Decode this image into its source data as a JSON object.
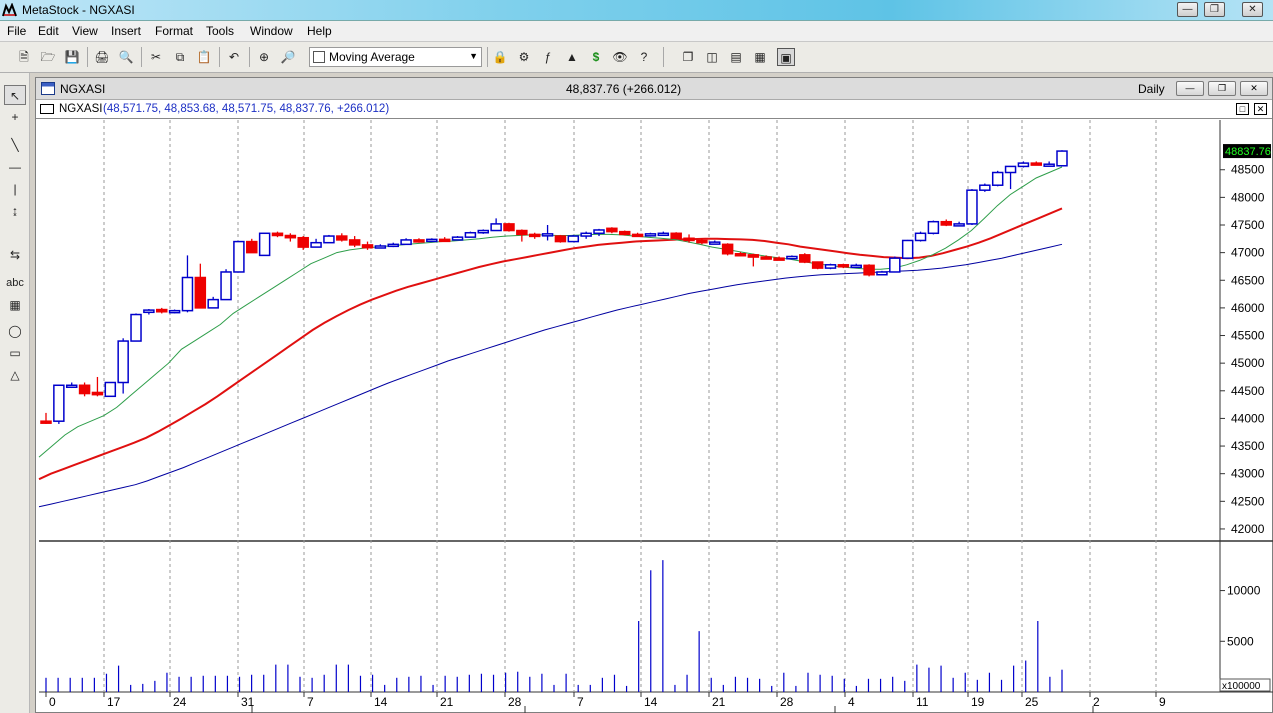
{
  "app": {
    "title": "MetaStock - NGXASI"
  },
  "menu": [
    "File",
    "Edit",
    "View",
    "Insert",
    "Format",
    "Tools",
    "Window",
    "Help"
  ],
  "toolbar": {
    "indicator_select": "Moving Average"
  },
  "window": {
    "title": "NGXASI",
    "price_change": "48,837.76 (+266.012)",
    "periodicity": "Daily"
  },
  "legend": {
    "name": "NGXASI",
    "values": "(48,571.75, 48,853.68, 48,571.75, 48,837.76, +266.012)"
  },
  "colors": {
    "up": "#0000cc",
    "down": "#ee0000",
    "ma_short": "#2e9e4a",
    "ma_mid": "#e01010",
    "ma_long": "#0000a0",
    "last_price_bg": "#000000",
    "last_price_fg": "#22ff22"
  },
  "chart_data": [
    {
      "type": "candlestick",
      "title": "NGXASI",
      "y_ticks": [
        42000,
        42500,
        43000,
        43500,
        44000,
        44500,
        45000,
        45500,
        46000,
        46500,
        47000,
        47500,
        48000,
        48500
      ],
      "y_tick_labels": [
        "42000",
        "42500",
        "43000",
        "43500",
        "44000",
        "44500",
        "45000",
        "45500",
        "46000",
        "46500",
        "47000",
        "47500",
        "48000",
        "48500"
      ],
      "ylim": [
        41800,
        49400
      ],
      "last_price_label": "48837.76",
      "x_tick_labels": [
        "0",
        "17",
        "24",
        "31",
        "7",
        "14",
        "21",
        "28",
        "7",
        "14",
        "21",
        "28",
        "4",
        "11",
        "19",
        "25",
        "2",
        "9"
      ],
      "candles": [
        {
          "o": 43950,
          "h": 44100,
          "l": 43900,
          "c": 43930
        },
        {
          "o": 43950,
          "h": 44600,
          "l": 43900,
          "c": 44600
        },
        {
          "o": 44600,
          "h": 44650,
          "l": 44550,
          "c": 44600
        },
        {
          "o": 44600,
          "h": 44650,
          "l": 44400,
          "c": 44450
        },
        {
          "o": 44470,
          "h": 44750,
          "l": 44400,
          "c": 44430
        },
        {
          "o": 44400,
          "h": 44650,
          "l": 44400,
          "c": 44650
        },
        {
          "o": 44650,
          "h": 45450,
          "l": 44450,
          "c": 45400
        },
        {
          "o": 45400,
          "h": 45900,
          "l": 45400,
          "c": 45880
        },
        {
          "o": 45920,
          "h": 45980,
          "l": 45880,
          "c": 45960
        },
        {
          "o": 45970,
          "h": 46000,
          "l": 45900,
          "c": 45930
        },
        {
          "o": 45930,
          "h": 45970,
          "l": 45900,
          "c": 45950
        },
        {
          "o": 45950,
          "h": 46950,
          "l": 45920,
          "c": 46550
        },
        {
          "o": 46550,
          "h": 46800,
          "l": 46000,
          "c": 46000
        },
        {
          "o": 46000,
          "h": 46200,
          "l": 46000,
          "c": 46150
        },
        {
          "o": 46150,
          "h": 46700,
          "l": 46150,
          "c": 46650
        },
        {
          "o": 46650,
          "h": 47200,
          "l": 46650,
          "c": 47200
        },
        {
          "o": 47200,
          "h": 47250,
          "l": 47000,
          "c": 47000
        },
        {
          "o": 46950,
          "h": 47350,
          "l": 46950,
          "c": 47350
        },
        {
          "o": 47350,
          "h": 47380,
          "l": 47280,
          "c": 47310
        },
        {
          "o": 47310,
          "h": 47350,
          "l": 47200,
          "c": 47270
        },
        {
          "o": 47270,
          "h": 47300,
          "l": 47050,
          "c": 47100
        },
        {
          "o": 47100,
          "h": 47250,
          "l": 47100,
          "c": 47180
        },
        {
          "o": 47180,
          "h": 47320,
          "l": 47180,
          "c": 47300
        },
        {
          "o": 47300,
          "h": 47350,
          "l": 47200,
          "c": 47230
        },
        {
          "o": 47230,
          "h": 47300,
          "l": 47100,
          "c": 47140
        },
        {
          "o": 47140,
          "h": 47200,
          "l": 47050,
          "c": 47090
        },
        {
          "o": 47090,
          "h": 47150,
          "l": 47080,
          "c": 47120
        },
        {
          "o": 47120,
          "h": 47180,
          "l": 47100,
          "c": 47150
        },
        {
          "o": 47150,
          "h": 47260,
          "l": 47150,
          "c": 47230
        },
        {
          "o": 47230,
          "h": 47260,
          "l": 47180,
          "c": 47210
        },
        {
          "o": 47210,
          "h": 47260,
          "l": 47190,
          "c": 47240
        },
        {
          "o": 47240,
          "h": 47280,
          "l": 47200,
          "c": 47230
        },
        {
          "o": 47230,
          "h": 47300,
          "l": 47230,
          "c": 47280
        },
        {
          "o": 47280,
          "h": 47380,
          "l": 47280,
          "c": 47360
        },
        {
          "o": 47360,
          "h": 47420,
          "l": 47340,
          "c": 47400
        },
        {
          "o": 47400,
          "h": 47620,
          "l": 47400,
          "c": 47520
        },
        {
          "o": 47520,
          "h": 47540,
          "l": 47380,
          "c": 47400
        },
        {
          "o": 47400,
          "h": 47420,
          "l": 47200,
          "c": 47330
        },
        {
          "o": 47330,
          "h": 47360,
          "l": 47250,
          "c": 47320
        },
        {
          "o": 47320,
          "h": 47500,
          "l": 47220,
          "c": 47340
        },
        {
          "o": 47300,
          "h": 47320,
          "l": 47180,
          "c": 47200
        },
        {
          "o": 47200,
          "h": 47320,
          "l": 47200,
          "c": 47300
        },
        {
          "o": 47300,
          "h": 47380,
          "l": 47250,
          "c": 47350
        },
        {
          "o": 47350,
          "h": 47430,
          "l": 47300,
          "c": 47410
        },
        {
          "o": 47440,
          "h": 47460,
          "l": 47350,
          "c": 47380
        },
        {
          "o": 47380,
          "h": 47400,
          "l": 47310,
          "c": 47330
        },
        {
          "o": 47330,
          "h": 47360,
          "l": 47300,
          "c": 47320
        },
        {
          "o": 47320,
          "h": 47360,
          "l": 47290,
          "c": 47340
        },
        {
          "o": 47340,
          "h": 47380,
          "l": 47320,
          "c": 47350
        },
        {
          "o": 47350,
          "h": 47370,
          "l": 47240,
          "c": 47260
        },
        {
          "o": 47260,
          "h": 47330,
          "l": 47180,
          "c": 47220
        },
        {
          "o": 47220,
          "h": 47260,
          "l": 47150,
          "c": 47180
        },
        {
          "o": 47180,
          "h": 47220,
          "l": 47150,
          "c": 47190
        },
        {
          "o": 47150,
          "h": 47170,
          "l": 46950,
          "c": 46980
        },
        {
          "o": 46980,
          "h": 47010,
          "l": 46940,
          "c": 46960
        },
        {
          "o": 46960,
          "h": 46980,
          "l": 46750,
          "c": 46920
        },
        {
          "o": 46920,
          "h": 46950,
          "l": 46880,
          "c": 46900
        },
        {
          "o": 46900,
          "h": 46930,
          "l": 46870,
          "c": 46890
        },
        {
          "o": 46890,
          "h": 46950,
          "l": 46880,
          "c": 46930
        },
        {
          "o": 46960,
          "h": 46990,
          "l": 46810,
          "c": 46830
        },
        {
          "o": 46830,
          "h": 46840,
          "l": 46700,
          "c": 46720
        },
        {
          "o": 46720,
          "h": 46800,
          "l": 46700,
          "c": 46780
        },
        {
          "o": 46780,
          "h": 46800,
          "l": 46720,
          "c": 46760
        },
        {
          "o": 46760,
          "h": 46800,
          "l": 46720,
          "c": 46770
        },
        {
          "o": 46770,
          "h": 46790,
          "l": 46570,
          "c": 46600
        },
        {
          "o": 46600,
          "h": 46670,
          "l": 46590,
          "c": 46650
        },
        {
          "o": 46650,
          "h": 46930,
          "l": 46640,
          "c": 46900
        },
        {
          "o": 46900,
          "h": 47230,
          "l": 46890,
          "c": 47220
        },
        {
          "o": 47220,
          "h": 47380,
          "l": 47200,
          "c": 47350
        },
        {
          "o": 47350,
          "h": 47580,
          "l": 47330,
          "c": 47560
        },
        {
          "o": 47560,
          "h": 47600,
          "l": 47480,
          "c": 47500
        },
        {
          "o": 47500,
          "h": 47560,
          "l": 47500,
          "c": 47520
        },
        {
          "o": 47520,
          "h": 48150,
          "l": 47500,
          "c": 48130
        },
        {
          "o": 48130,
          "h": 48250,
          "l": 48100,
          "c": 48220
        },
        {
          "o": 48220,
          "h": 48480,
          "l": 48200,
          "c": 48450
        },
        {
          "o": 48450,
          "h": 48560,
          "l": 48150,
          "c": 48560
        },
        {
          "o": 48560,
          "h": 48650,
          "l": 48540,
          "c": 48620
        },
        {
          "o": 48620,
          "h": 48650,
          "l": 48580,
          "c": 48600
        },
        {
          "o": 48600,
          "h": 48650,
          "l": 48560,
          "c": 48600
        },
        {
          "o": 48571.75,
          "h": 48853.68,
          "l": 48571.75,
          "c": 48837.76
        }
      ],
      "ma_short": [
        43300,
        43500,
        43700,
        43850,
        43950,
        44050,
        44200,
        44400,
        44600,
        44800,
        45000,
        45250,
        45400,
        45550,
        45700,
        45900,
        46050,
        46200,
        46350,
        46500,
        46650,
        46800,
        46900,
        47000,
        47050,
        47080,
        47100,
        47120,
        47140,
        47160,
        47180,
        47200,
        47210,
        47230,
        47250,
        47280,
        47300,
        47310,
        47320,
        47320,
        47310,
        47310,
        47320,
        47330,
        47330,
        47320,
        47300,
        47280,
        47260,
        47240,
        47200,
        47150,
        47100,
        47060,
        47020,
        46980,
        46940,
        46910,
        46880,
        46840,
        46800,
        46770,
        46740,
        46720,
        46700,
        46700,
        46720,
        46780,
        46860,
        46960,
        47080,
        47230,
        47400,
        47620,
        47850,
        48050,
        48200,
        48350,
        48450,
        48550
      ],
      "ma_mid": [
        42900,
        43000,
        43080,
        43160,
        43240,
        43320,
        43400,
        43480,
        43560,
        43650,
        43760,
        43880,
        44000,
        44130,
        44260,
        44400,
        44550,
        44700,
        44850,
        45000,
        45150,
        45300,
        45450,
        45600,
        45730,
        45850,
        45960,
        46060,
        46150,
        46230,
        46310,
        46380,
        46440,
        46500,
        46560,
        46620,
        46680,
        46740,
        46790,
        46840,
        46880,
        46920,
        46960,
        47000,
        47040,
        47080,
        47110,
        47140,
        47160,
        47180,
        47200,
        47210,
        47220,
        47230,
        47240,
        47245,
        47250,
        47250,
        47245,
        47240,
        47230,
        47210,
        47180,
        47150,
        47110,
        47080,
        47050,
        47020,
        46990,
        46960,
        46940,
        46920,
        46910,
        46900,
        46910,
        46940,
        46990,
        47050,
        47110,
        47180,
        47260,
        47350,
        47440,
        47530,
        47620,
        47710,
        47800
      ],
      "ma_long": [
        42400,
        42450,
        42500,
        42550,
        42600,
        42650,
        42700,
        42750,
        42800,
        42870,
        42950,
        43030,
        43110,
        43200,
        43290,
        43380,
        43470,
        43560,
        43650,
        43740,
        43830,
        43920,
        44010,
        44100,
        44190,
        44280,
        44370,
        44460,
        44550,
        44640,
        44720,
        44800,
        44880,
        44960,
        45040,
        45110,
        45180,
        45250,
        45320,
        45390,
        45460,
        45530,
        45600,
        45660,
        45720,
        45780,
        45840,
        45900,
        45960,
        46010,
        46060,
        46110,
        46160,
        46210,
        46260,
        46300,
        46340,
        46380,
        46420,
        46450,
        46480,
        46510,
        46540,
        46560,
        46580,
        46600,
        46610,
        46620,
        46630,
        46640,
        46650,
        46660,
        46670,
        46680,
        46700,
        46720,
        46750,
        46780,
        46820,
        46860,
        46900,
        46950,
        47000,
        47050,
        47100,
        47150
      ],
      "volume": {
        "unit_label": "x100000",
        "y_ticks": [
          5000,
          10000
        ],
        "values": [
          1400,
          1400,
          1400,
          1400,
          1400,
          1800,
          2600,
          700,
          800,
          1100,
          1900,
          1500,
          1500,
          1600,
          1600,
          1600,
          1500,
          1700,
          1700,
          2700,
          2700,
          1500,
          1400,
          1700,
          2700,
          2700,
          1600,
          1700,
          700,
          1400,
          1500,
          1600,
          700,
          1600,
          1500,
          1700,
          1800,
          1700,
          1900,
          2000,
          1500,
          1800,
          700,
          1800,
          700,
          700,
          1400,
          1700,
          600,
          7000,
          12000,
          13000,
          700,
          1700,
          6000,
          1400,
          700,
          1500,
          1400,
          1300,
          600,
          1900,
          600,
          1900,
          1700,
          1600,
          1300,
          600,
          1300,
          1300,
          1500,
          1100,
          2700,
          2400,
          2600,
          1400,
          1900,
          1200,
          1900,
          1200,
          2600,
          3100,
          7000,
          1500,
          2200
        ]
      }
    }
  ]
}
